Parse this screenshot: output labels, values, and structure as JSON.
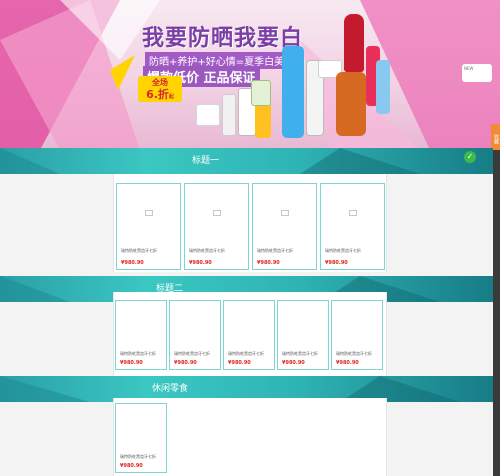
{
  "banner": {
    "headline": "我要防晒我要白",
    "sub1": "防晒+养护+好心情=夏季白美人",
    "sub2": "爆款低价 正品保证",
    "badge_top": "全场",
    "badge_big": "6.折",
    "badge_small": "起",
    "side_widget_text": "NEW",
    "side_tab": "收藏"
  },
  "sections": [
    {
      "title": "标题一",
      "products": [
        {
          "name": "瑞特防蛀黑齿牙七折",
          "price": "¥980.90"
        },
        {
          "name": "瑞特防蛀黑齿牙七折",
          "price": "¥980.90"
        },
        {
          "name": "瑞特防蛀黑齿牙七折",
          "price": "¥980.90"
        },
        {
          "name": "瑞特防蛀黑齿牙七折",
          "price": "¥980.90"
        }
      ]
    },
    {
      "title": "标题二",
      "products": [
        {
          "name": "瑞特防蛀黑齿牙七折",
          "price": "¥980.90"
        },
        {
          "name": "瑞特防蛀黑齿牙七折",
          "price": "¥980.90"
        },
        {
          "name": "瑞特防蛀黑齿牙七折",
          "price": "¥980.90"
        },
        {
          "name": "瑞特防蛀黑齿牙七折",
          "price": "¥980.90"
        },
        {
          "name": "瑞特防蛀黑齿牙七折",
          "price": "¥980.90"
        }
      ]
    },
    {
      "title": "休闲零食",
      "products": [
        {
          "name": "瑞特防蛀黑齿牙七折",
          "price": "¥980.90"
        }
      ]
    }
  ],
  "colors": {
    "accent": "#2fb4b4",
    "price": "#e0261f",
    "headline": "#7a3fa6"
  }
}
